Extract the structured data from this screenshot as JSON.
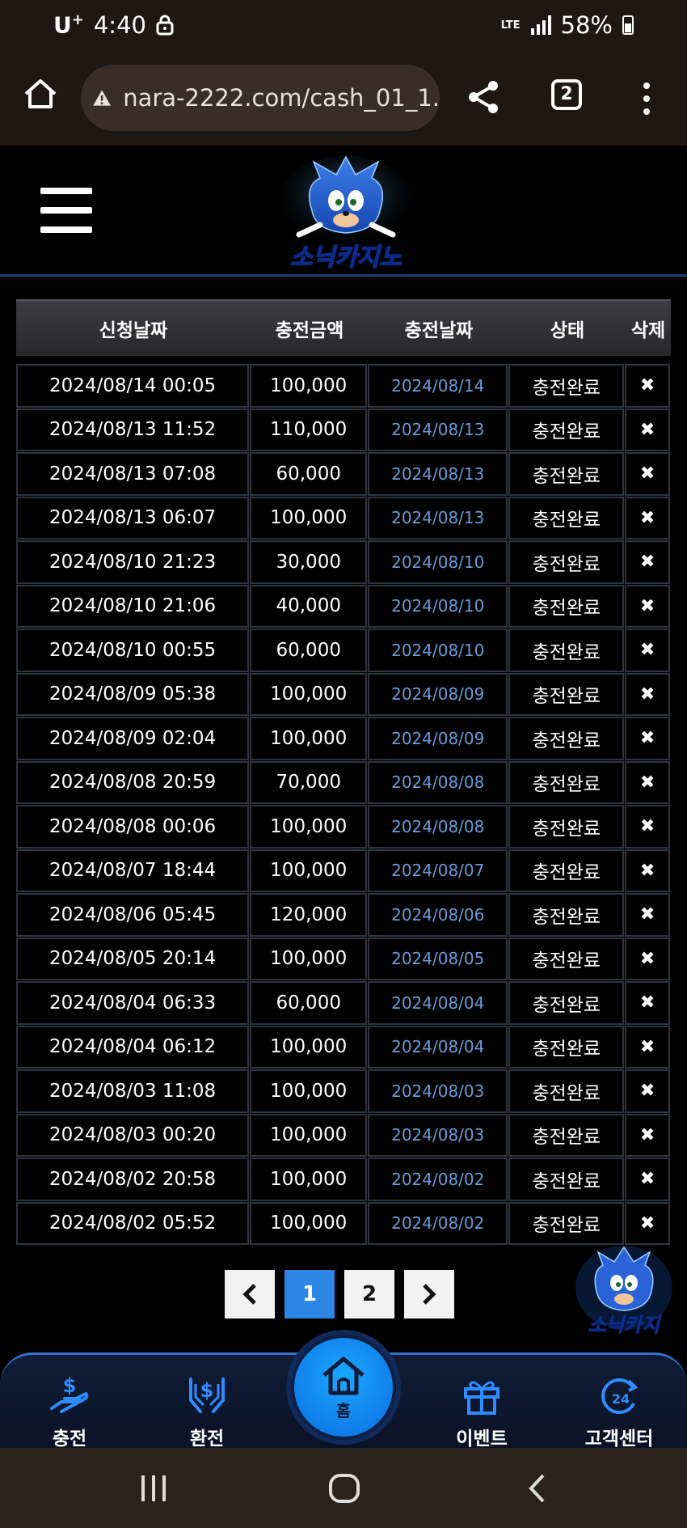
{
  "status_bar": {
    "carrier": "U",
    "carrier_sup": "+",
    "time": "4:40",
    "network": "LTE",
    "battery": "58%"
  },
  "browser": {
    "url": "nara-2222.com/cash_01_1.",
    "tab_count": "2"
  },
  "table": {
    "headers": [
      "신청날짜",
      "충전금액",
      "충전날짜",
      "상태",
      "삭제"
    ],
    "rows": [
      [
        "2024/08/14 00:05",
        "100,000",
        "2024/08/14",
        "충전완료",
        "✖"
      ],
      [
        "2024/08/13 11:52",
        "110,000",
        "2024/08/13",
        "충전완료",
        "✖"
      ],
      [
        "2024/08/13 07:08",
        "60,000",
        "2024/08/13",
        "충전완료",
        "✖"
      ],
      [
        "2024/08/13 06:07",
        "100,000",
        "2024/08/13",
        "충전완료",
        "✖"
      ],
      [
        "2024/08/10 21:23",
        "30,000",
        "2024/08/10",
        "충전완료",
        "✖"
      ],
      [
        "2024/08/10 21:06",
        "40,000",
        "2024/08/10",
        "충전완료",
        "✖"
      ],
      [
        "2024/08/10 00:55",
        "60,000",
        "2024/08/10",
        "충전완료",
        "✖"
      ],
      [
        "2024/08/09 05:38",
        "100,000",
        "2024/08/09",
        "충전완료",
        "✖"
      ],
      [
        "2024/08/09 02:04",
        "100,000",
        "2024/08/09",
        "충전완료",
        "✖"
      ],
      [
        "2024/08/08 20:59",
        "70,000",
        "2024/08/08",
        "충전완료",
        "✖"
      ],
      [
        "2024/08/08 00:06",
        "100,000",
        "2024/08/08",
        "충전완료",
        "✖"
      ],
      [
        "2024/08/07 18:44",
        "100,000",
        "2024/08/07",
        "충전완료",
        "✖"
      ],
      [
        "2024/08/06 05:45",
        "120,000",
        "2024/08/06",
        "충전완료",
        "✖"
      ],
      [
        "2024/08/05 20:14",
        "100,000",
        "2024/08/05",
        "충전완료",
        "✖"
      ],
      [
        "2024/08/04 06:33",
        "60,000",
        "2024/08/04",
        "충전완료",
        "✖"
      ],
      [
        "2024/08/04 06:12",
        "100,000",
        "2024/08/04",
        "충전완료",
        "✖"
      ],
      [
        "2024/08/03 11:08",
        "100,000",
        "2024/08/03",
        "충전완료",
        "✖"
      ],
      [
        "2024/08/03 00:20",
        "100,000",
        "2024/08/03",
        "충전완료",
        "✖"
      ],
      [
        "2024/08/02 20:58",
        "100,000",
        "2024/08/02",
        "충전완료",
        "✖"
      ],
      [
        "2024/08/02 05:52",
        "100,000",
        "2024/08/02",
        "충전완료",
        "✖"
      ]
    ]
  },
  "pagination": {
    "prev": "‹",
    "pages": [
      "1",
      "2"
    ],
    "active": "1",
    "next": "›"
  },
  "logo": {
    "text": "소닉카지노",
    "float_text": "소닉카지"
  },
  "bottom_nav": {
    "items": [
      {
        "label": "충전",
        "icon": "hand-dollar-icon"
      },
      {
        "label": "환전",
        "icon": "hands-dollar-icon"
      },
      {
        "label": "홈",
        "icon": "home-icon"
      },
      {
        "label": "이벤트",
        "icon": "gift-icon"
      },
      {
        "label": "고객센터",
        "icon": "support-24-icon"
      }
    ]
  },
  "colors": {
    "accent": "#2b86e6",
    "date_link": "#6a9bd8",
    "nav_bg": "#0a1226",
    "browser_bg": "#1f1713"
  }
}
